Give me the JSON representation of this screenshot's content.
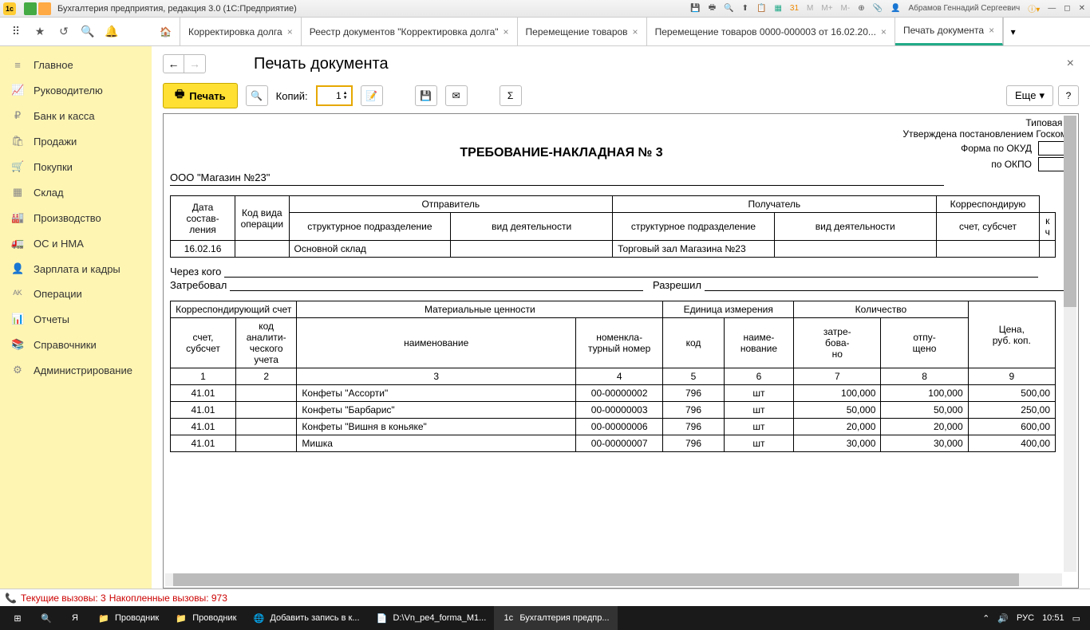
{
  "titlebar": {
    "app_title": "Бухгалтерия предприятия, редакция 3.0  (1С:Предприятие)",
    "user": "Абрамов Геннадий Сергеевич",
    "m": "M",
    "mplus": "M+",
    "mminus": "M-"
  },
  "tabs": [
    {
      "label": "Корректировка долга"
    },
    {
      "label": "Реестр документов \"Корректировка долга\""
    },
    {
      "label": "Перемещение товаров"
    },
    {
      "label": "Перемещение товаров 0000-000003 от 16.02.20..."
    },
    {
      "label": "Печать документа"
    }
  ],
  "sidebar": [
    {
      "icon": "≡",
      "label": "Главное"
    },
    {
      "icon": "📈",
      "label": "Руководителю"
    },
    {
      "icon": "₽",
      "label": "Банк и касса"
    },
    {
      "icon": "🛍",
      "label": "Продажи"
    },
    {
      "icon": "🛒",
      "label": "Покупки"
    },
    {
      "icon": "▦",
      "label": "Склад"
    },
    {
      "icon": "🏭",
      "label": "Производство"
    },
    {
      "icon": "🚛",
      "label": "ОС и НМА"
    },
    {
      "icon": "👤",
      "label": "Зарплата и кадры"
    },
    {
      "icon": "ᴬᴷ",
      "label": "Операции"
    },
    {
      "icon": "📊",
      "label": "Отчеты"
    },
    {
      "icon": "📚",
      "label": "Справочники"
    },
    {
      "icon": "⚙",
      "label": "Администрирование"
    }
  ],
  "page": {
    "title": "Печать документа"
  },
  "toolbar": {
    "print": "Печать",
    "copies_label": "Копий:",
    "copies": "1",
    "more": "Еще",
    "help": "?"
  },
  "doc": {
    "typical": "Типовая м",
    "approved": "Утверждена постановлением Госкомс",
    "title": "ТРЕБОВАНИЕ-НАКЛАДНАЯ № 3",
    "form_okud": "Форма по ОКУД",
    "po_okpo": "по ОКПО",
    "org": "ООО \"Магазин №23\"",
    "h1": {
      "date": "Дата состав-\nления",
      "opcode": "Код вида операции",
      "sender": "Отправитель",
      "receiver": "Получатель",
      "corr": "Корреспондирую",
      "struct": "структурное подразделение",
      "activity": "вид деятельности",
      "account": "счет, субсчет",
      "k": "к\nч"
    },
    "row1": {
      "date": "16.02.16",
      "sender_struct": "Основной склад",
      "receiver_struct": "Торговый зал Магазина №23"
    },
    "through": "Через кого",
    "requested": "Затребовал",
    "allowed": "Разрешил",
    "h2": {
      "corr_acc": "Корреспондирующий счет",
      "material": "Материальные ценности",
      "unit": "Единица измерения",
      "qty": "Количество",
      "price": "Цена,\nруб. коп.",
      "acc": "счет, субсчет",
      "analyt": "код аналити-\nческого учета",
      "name": "наименование",
      "nomen": "номенкла-\nтурный номер",
      "code": "код",
      "unitname": "наиме-\nнование",
      "req": "затре-\nбова-\nно",
      "rel": "отпу-\nщено"
    },
    "nums": [
      "1",
      "2",
      "3",
      "4",
      "5",
      "6",
      "7",
      "8",
      "9"
    ],
    "rows": [
      {
        "acc": "41.01",
        "name": "Конфеты \"Ассорти\"",
        "nomen": "00-00000002",
        "code": "796",
        "unit": "шт",
        "req": "100,000",
        "rel": "100,000",
        "price": "500,00"
      },
      {
        "acc": "41.01",
        "name": "Конфеты \"Барбарис\"",
        "nomen": "00-00000003",
        "code": "796",
        "unit": "шт",
        "req": "50,000",
        "rel": "50,000",
        "price": "250,00"
      },
      {
        "acc": "41.01",
        "name": "Конфеты \"Вишня в коньяке\"",
        "nomen": "00-00000006",
        "code": "796",
        "unit": "шт",
        "req": "20,000",
        "rel": "20,000",
        "price": "600,00"
      },
      {
        "acc": "41.01",
        "name": "Мишка",
        "nomen": "00-00000007",
        "code": "796",
        "unit": "шт",
        "req": "30,000",
        "rel": "30,000",
        "price": "400,00"
      }
    ]
  },
  "status": {
    "current": "Текущие вызовы:  3",
    "accum": "Накопленные вызовы:  973"
  },
  "taskbar": {
    "items": [
      {
        "icon": "⊞",
        "label": ""
      },
      {
        "icon": "🔍",
        "label": ""
      },
      {
        "icon": "Я",
        "label": ""
      },
      {
        "icon": "📁",
        "label": "Проводник"
      },
      {
        "icon": "📁",
        "label": "Проводник"
      },
      {
        "icon": "🌐",
        "label": "Добавить запись в к..."
      },
      {
        "icon": "📄",
        "label": "D:\\Vn_pe4_forma_M1..."
      },
      {
        "icon": "1с",
        "label": "Бухгалтерия предпр..."
      }
    ],
    "lang": "РУС",
    "time": "10:51"
  }
}
